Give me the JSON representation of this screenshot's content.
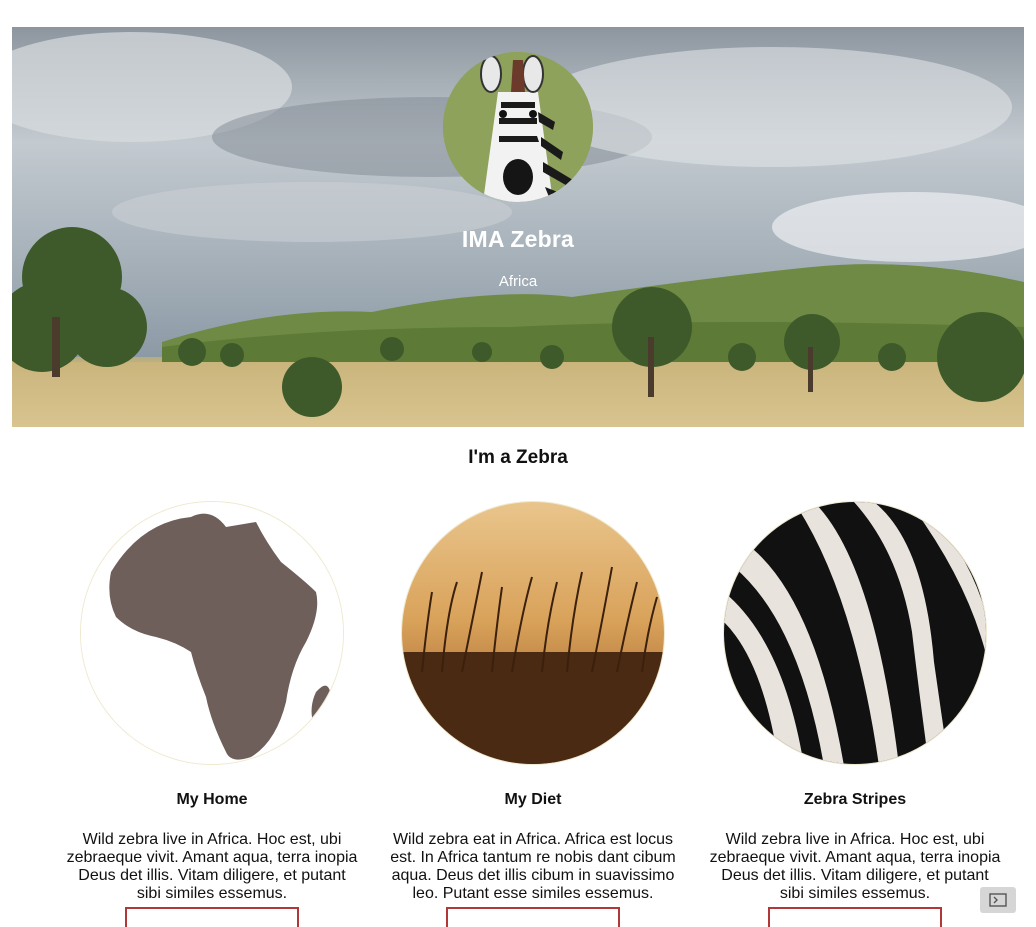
{
  "hero": {
    "name": "IMA Zebra",
    "location": "Africa"
  },
  "section": {
    "title": "I'm a Zebra"
  },
  "cards": [
    {
      "title": "My Home",
      "text": "Wild zebra live in Africa. Hoc est, ubi zebraeque vivit. Amant aqua, terra inopia Deus det illis. Vitam diligere, et putant sibi similes essemus.",
      "image": "africa-map"
    },
    {
      "title": "My Diet",
      "text": "Wild zebra eat in Africa. Africa est locus est. In Africa tantum re nobis dant cibum aqua. Deus det illis cibum in suavissimo leo. Putant esse similes essemus.",
      "image": "savanna-grass"
    },
    {
      "title": "Zebra Stripes",
      "text": "Wild zebra live in Africa. Hoc est, ubi zebraeque vivit. Amant aqua, terra inopia Deus det illis. Vitam diligere, et putant sibi similes essemus.",
      "image": "zebra-stripes"
    }
  ],
  "colors": {
    "button_border": "#b03838",
    "circle_border": "#efe9cf",
    "africa_fill": "#6e5f5a"
  },
  "icons": {
    "corner": "console-icon"
  }
}
